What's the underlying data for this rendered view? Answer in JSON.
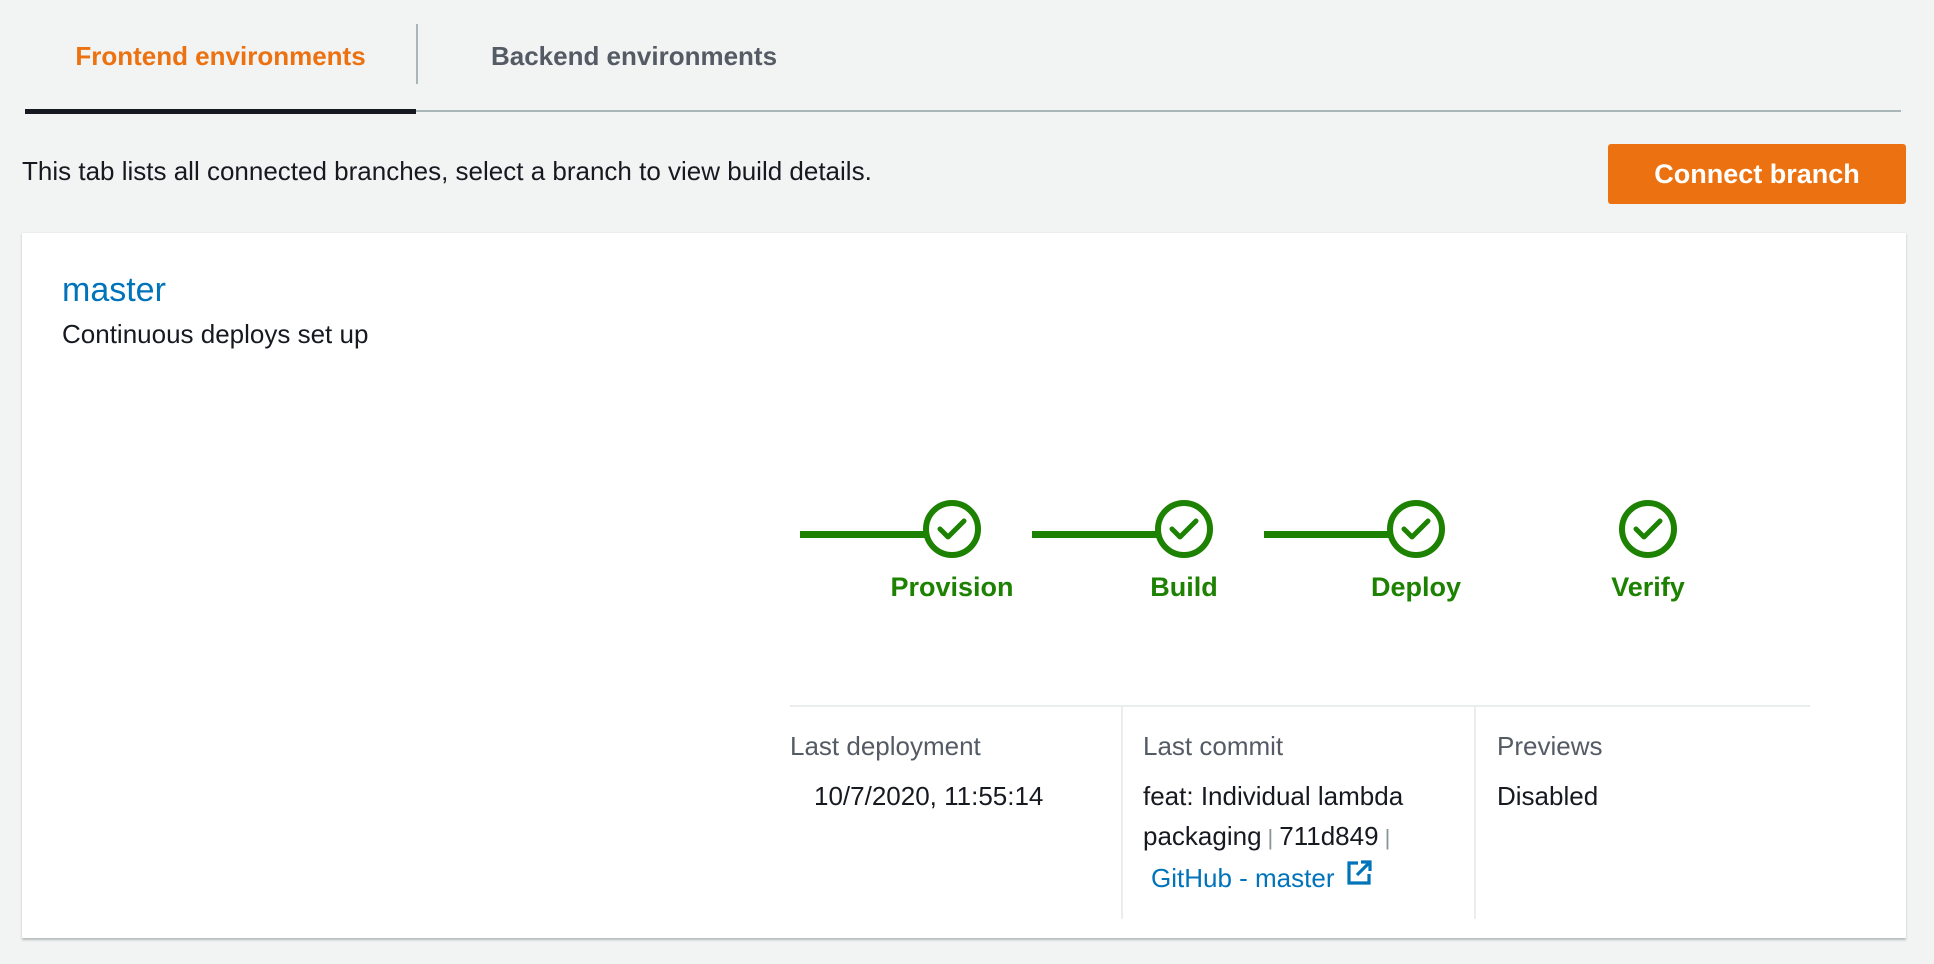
{
  "tabs": [
    {
      "label": "Frontend environments",
      "active": true
    },
    {
      "label": "Backend environments",
      "active": false
    }
  ],
  "description": "This tab lists all connected branches, select a branch to view build details.",
  "connect_button": "Connect branch",
  "branch": {
    "name": "master",
    "status": "Continuous deploys set up"
  },
  "pipeline": {
    "color": "#1d8102",
    "steps": [
      {
        "label": "Provision",
        "icon": "check-circle-icon",
        "state": "succeeded"
      },
      {
        "label": "Build",
        "icon": "check-circle-icon",
        "state": "succeeded"
      },
      {
        "label": "Deploy",
        "icon": "check-circle-icon",
        "state": "succeeded"
      },
      {
        "label": "Verify",
        "icon": "check-circle-icon",
        "state": "succeeded"
      }
    ]
  },
  "info": {
    "last_deployment": {
      "label": "Last deployment",
      "value": "10/7/2020, 11:55:14"
    },
    "last_commit": {
      "label": "Last commit",
      "message_line1": "feat: Individual lambda",
      "message_line2": "packaging",
      "hash": "711d849",
      "separator": "|",
      "link_text": "GitHub - master",
      "link_icon": "external-link-icon"
    },
    "previews": {
      "label": "Previews",
      "value": "Disabled"
    }
  },
  "colors": {
    "accent": "#ec7211",
    "link": "#0073bb",
    "success": "#1d8102"
  }
}
